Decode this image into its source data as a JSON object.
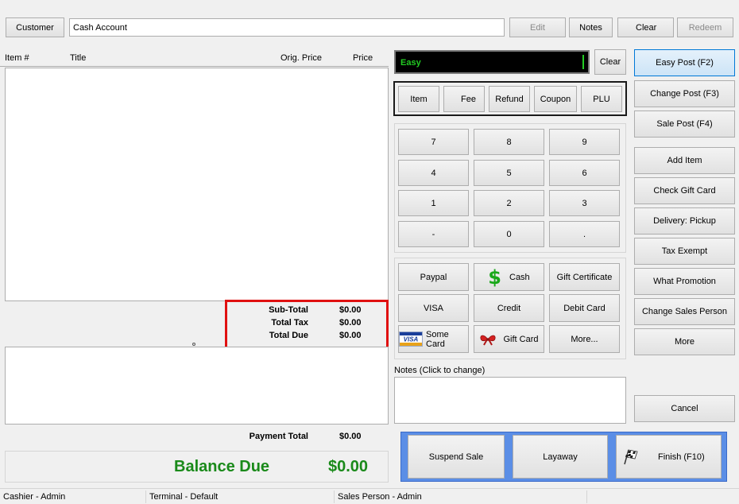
{
  "top": {
    "customer_label": "Customer",
    "account_value": "Cash Account",
    "edit_label": "Edit",
    "notes_label": "Notes",
    "clear_label": "Clear",
    "redeem_label": "Redeem"
  },
  "items_table": {
    "columns": [
      "Item #",
      "Title",
      "Orig. Price",
      "Price"
    ],
    "rows": []
  },
  "totals": {
    "subtotal_label": "Sub-Total",
    "subtotal_value": "$0.00",
    "tax_label": "Total Tax",
    "tax_value": "$0.00",
    "due_label": "Total Due",
    "due_value": "$0.00",
    "payment_label": "Payment Total",
    "payment_value": "$0.00",
    "balance_label": "Balance Due",
    "balance_value": "$0.00"
  },
  "entry": {
    "value": "Easy",
    "clear_label": "Clear"
  },
  "modes": [
    "Item",
    "Fee",
    "Refund",
    "Coupon",
    "PLU"
  ],
  "keypad": [
    "7",
    "8",
    "9",
    "4",
    "5",
    "6",
    "1",
    "2",
    "3",
    "-",
    "0",
    "."
  ],
  "payments": {
    "paypal": "Paypal",
    "cash": "Cash",
    "gift_certificate": "Gift Certificate",
    "visa": "VISA",
    "credit": "Credit",
    "debit": "Debit Card",
    "some_card": "Some Card",
    "gift_card": "Gift Card",
    "more": "More..."
  },
  "notes": {
    "label": "Notes (Click to change)",
    "value": ""
  },
  "actions": {
    "suspend": "Suspend Sale",
    "layaway": "Layaway",
    "finish": "Finish (F10)"
  },
  "side": {
    "easy_post": "Easy Post (F2)",
    "change_post": "Change Post (F3)",
    "sale_post": "Sale Post (F4)",
    "add_item": "Add Item",
    "check_gift": "Check Gift Card",
    "delivery": "Delivery: Pickup",
    "tax_exempt": "Tax Exempt",
    "what_promo": "What Promotion",
    "change_sales": "Change Sales Person",
    "more": "More",
    "cancel": "Cancel"
  },
  "status": {
    "cashier": "Cashier - Admin",
    "terminal": "Terminal - Default",
    "sales_person": "Sales Person - Admin"
  },
  "colors": {
    "balance_green": "#1a8a1a",
    "highlight_red": "#e01010",
    "entry_text_green": "#22cc22",
    "action_panel_blue": "#5b8ee6"
  },
  "icons": {
    "cash": "dollar-icon",
    "some_card": "visa-card-icon",
    "gift_card": "gift-ribbon-icon",
    "finish": "checkered-flag-icon"
  }
}
